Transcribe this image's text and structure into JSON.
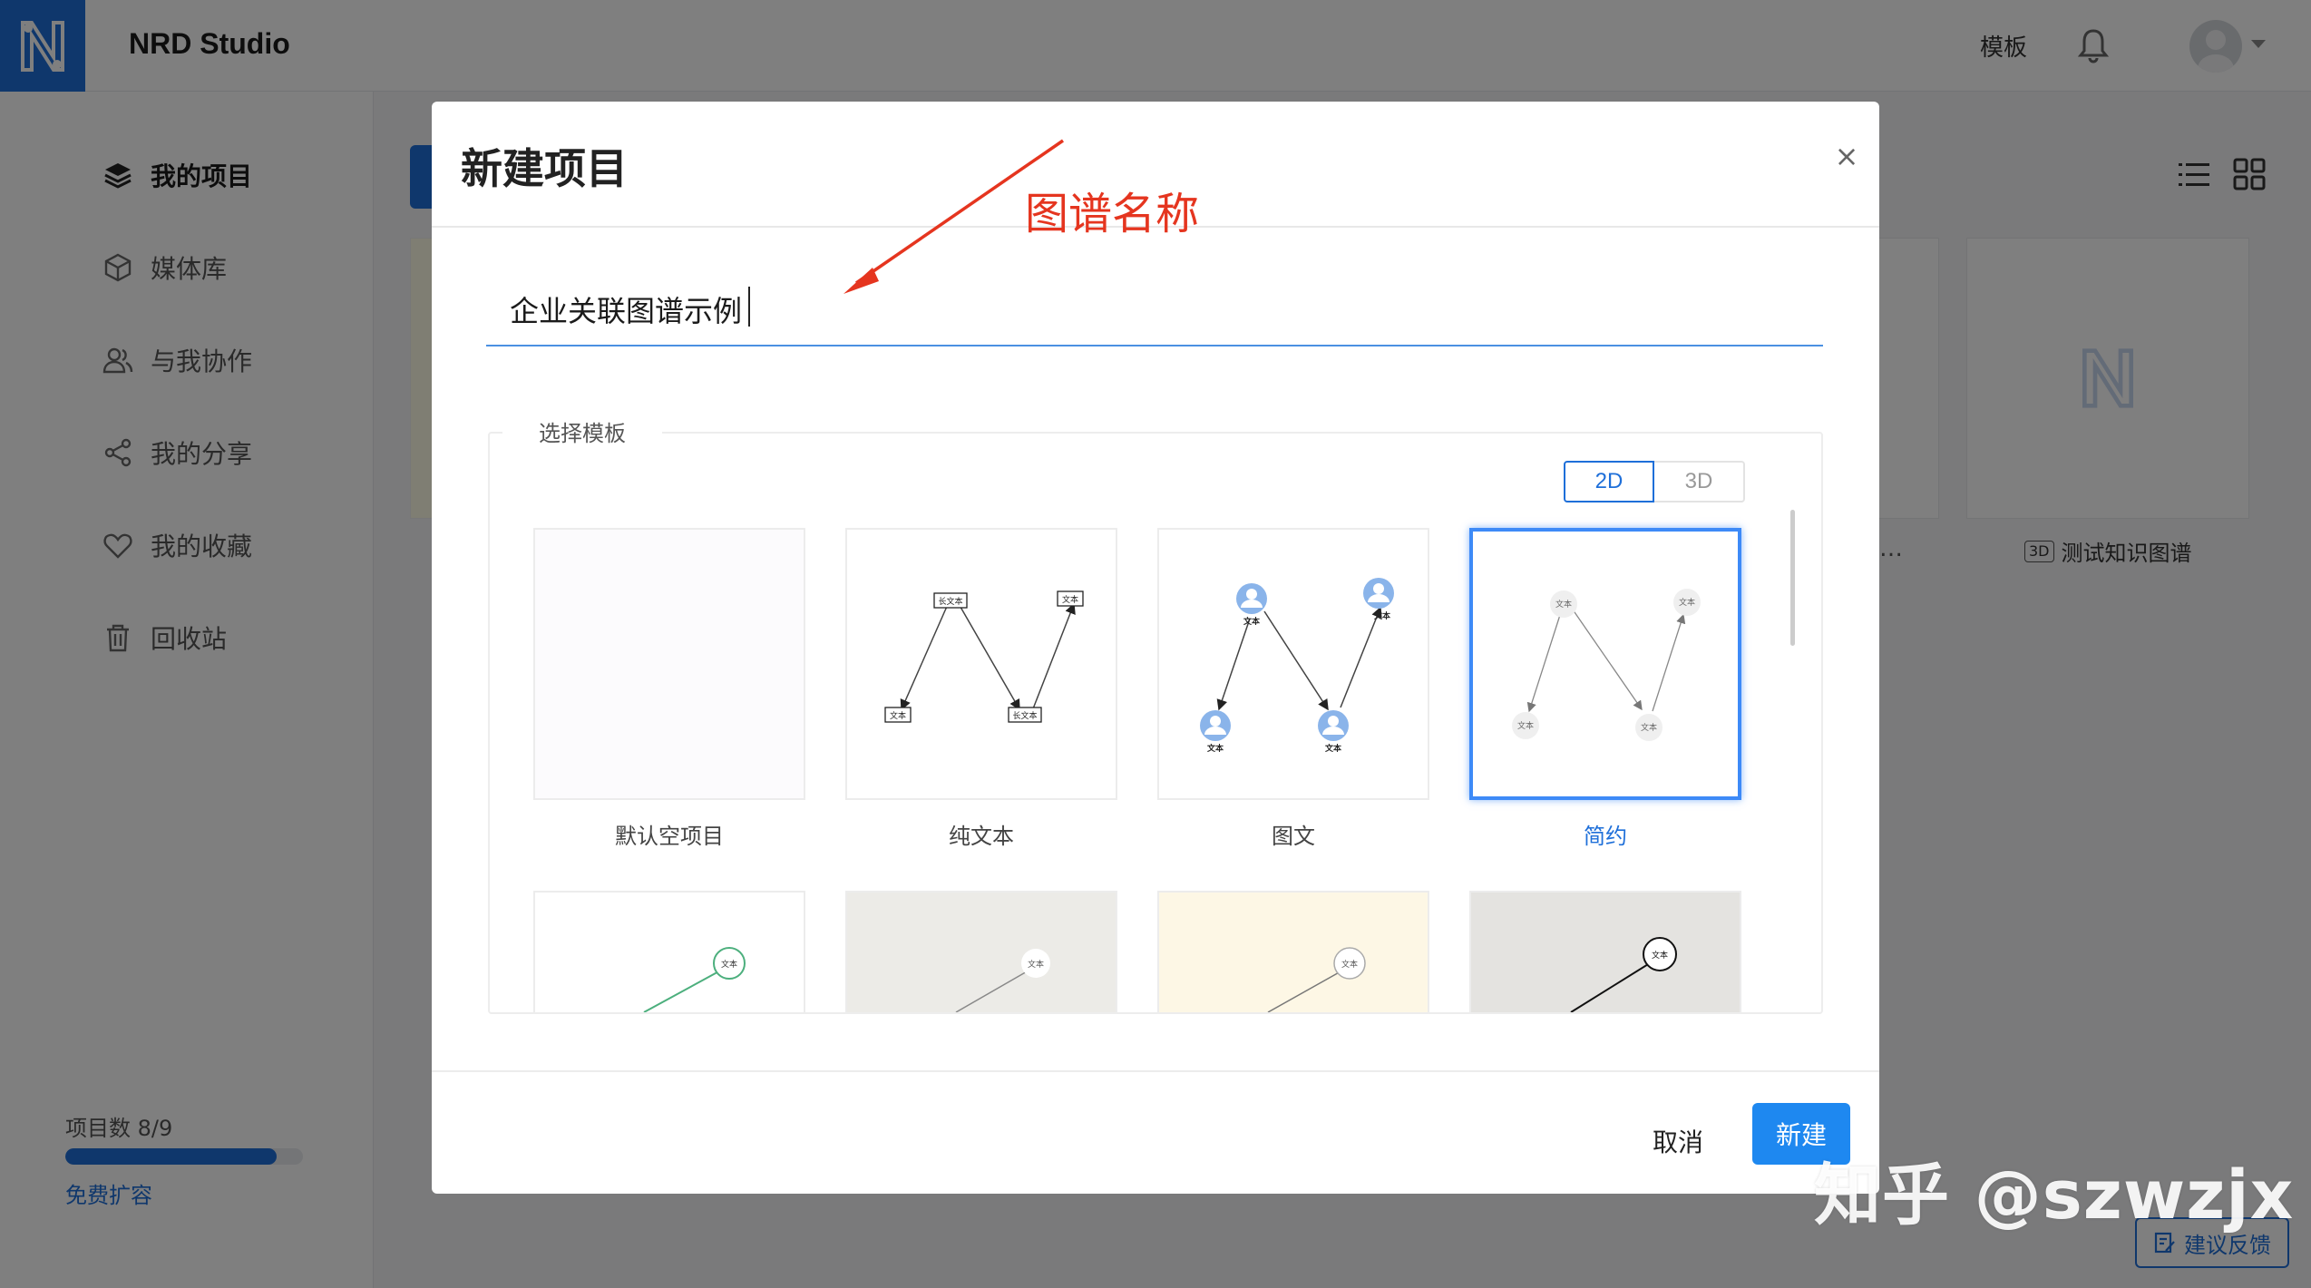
{
  "header": {
    "app_title": "NRD Studio",
    "templates_label": "模板",
    "bell_icon": "bell-icon",
    "avatar_icon": "user-avatar-icon"
  },
  "sidebar": {
    "items": [
      {
        "label": "我的项目",
        "icon": "layers-icon",
        "active": true
      },
      {
        "label": "媒体库",
        "icon": "box-icon",
        "active": false
      },
      {
        "label": "与我协作",
        "icon": "users-icon",
        "active": false
      },
      {
        "label": "我的分享",
        "icon": "share-icon",
        "active": false
      },
      {
        "label": "我的收藏",
        "icon": "heart-icon",
        "active": false
      },
      {
        "label": "回收站",
        "icon": "trash-icon",
        "active": false
      }
    ],
    "quota": {
      "label": "项目数 8/9",
      "used": 8,
      "total": 9,
      "expand_label": "免费扩容"
    }
  },
  "background": {
    "card_ellipsis": "…",
    "card_badge": "3D",
    "card_label": "测试知识图谱",
    "feedback_label": "建议反馈"
  },
  "modal": {
    "title": "新建项目",
    "close_glyph": "×",
    "annotation": "图谱名称",
    "name_value": "企业关联图谱示例",
    "template_section_label": "选择模板",
    "mode_options": [
      "2D",
      "3D"
    ],
    "mode_selected": "2D",
    "templates": [
      {
        "label": "默认空项目",
        "style": "blank",
        "selected": false
      },
      {
        "label": "纯文本",
        "style": "text",
        "selected": false
      },
      {
        "label": "图文",
        "style": "icon",
        "selected": false
      },
      {
        "label": "简约",
        "style": "simple",
        "selected": true
      }
    ],
    "node_text": "文本",
    "node_text_long": "长文本",
    "cancel_label": "取消",
    "create_label": "新建"
  },
  "watermark": "知乎 @szwzjx",
  "colors": {
    "accent": "#1e6fd9",
    "annotation": "#e5351f",
    "selected_border": "#3d8af7"
  }
}
